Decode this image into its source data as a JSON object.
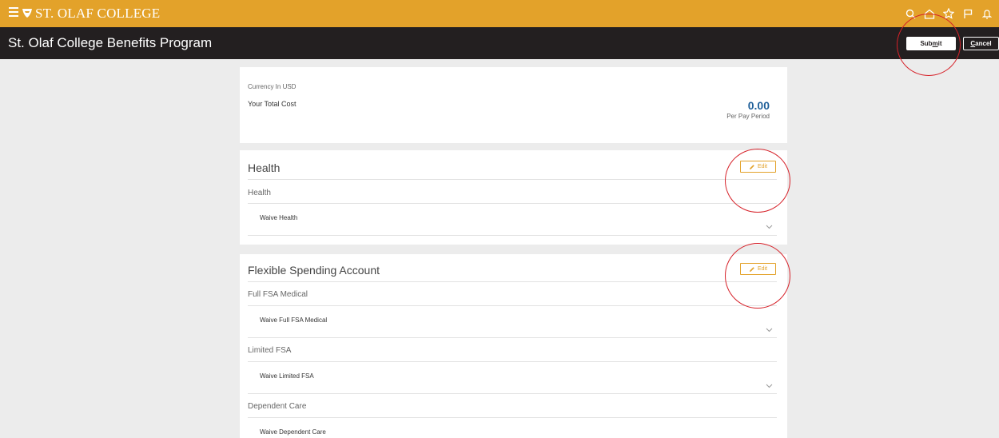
{
  "topbar": {
    "logo_part1": "ST. OLAF",
    "logo_part2": "COLLEGE",
    "icons": [
      "search-icon",
      "home-icon",
      "star-icon",
      "flag-icon",
      "bell-icon"
    ]
  },
  "header": {
    "title": "St. Olaf College Benefits Program",
    "submit_prefix": "Sub",
    "submit_underlined": "m",
    "submit_suffix": "it",
    "cancel_underlined": "C",
    "cancel_suffix": "ancel"
  },
  "cost": {
    "currency": "Currency In USD",
    "total_label": "Your Total Cost",
    "total_value": "0.00",
    "per_period": "Per Pay Period"
  },
  "health": {
    "title": "Health",
    "edit_label": "Edit",
    "sub_label": "Health",
    "row": "Waive Health"
  },
  "fsa": {
    "title": "Flexible Spending Account",
    "edit_label": "Edit",
    "items": [
      {
        "label": "Full FSA Medical",
        "row": "Waive Full FSA Medical"
      },
      {
        "label": "Limited FSA",
        "row": "Waive Limited FSA"
      },
      {
        "label": "Dependent Care",
        "row": "Waive Dependent Care"
      }
    ]
  },
  "colors": {
    "brand_gold": "#e3a22a",
    "header_dark": "#231f20",
    "accent_blue": "#1f5f99",
    "annotation_red": "#d62028"
  }
}
